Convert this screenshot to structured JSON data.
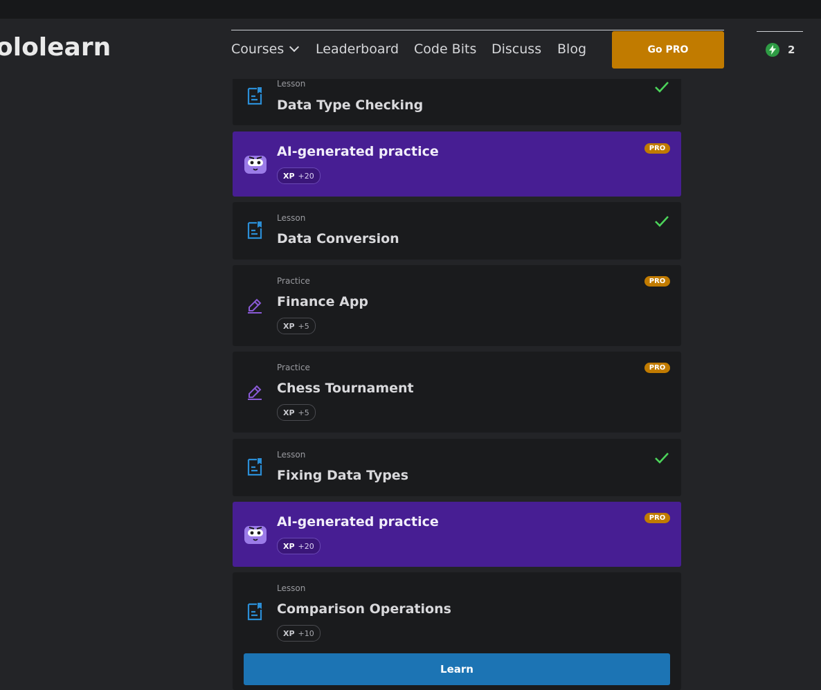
{
  "header": {
    "logo_text": "ololearn",
    "nav": {
      "courses": "Courses",
      "leaderboard": "Leaderboard",
      "code_bits": "Code Bits",
      "discuss": "Discuss",
      "blog": "Blog"
    },
    "go_pro": "Go PRO",
    "streak_count": "2"
  },
  "colors": {
    "background": "#232427",
    "card": "#1a1b1d",
    "ai_card": "#471e93",
    "pro_badge": "#c17b00",
    "learn_button": "#1c74b4",
    "check": "#4cd45a",
    "lesson_icon": "#2b8ed6",
    "practice_icon": "#8a5ad6"
  },
  "items": [
    {
      "type": "Lesson",
      "title": "Data Type Checking",
      "completed": true,
      "icon": "lesson-icon"
    },
    {
      "type": "",
      "title": "AI-generated practice",
      "xp_label": "XP",
      "xp": "+20",
      "pro": "PRO",
      "icon": "mascot-icon"
    },
    {
      "type": "Lesson",
      "title": "Data Conversion",
      "completed": true,
      "icon": "lesson-icon"
    },
    {
      "type": "Practice",
      "title": "Finance App",
      "xp_label": "XP",
      "xp": "+5",
      "pro": "PRO",
      "icon": "practice-icon"
    },
    {
      "type": "Practice",
      "title": "Chess Tournament",
      "xp_label": "XP",
      "xp": "+5",
      "pro": "PRO",
      "icon": "practice-icon"
    },
    {
      "type": "Lesson",
      "title": "Fixing Data Types",
      "completed": true,
      "icon": "lesson-icon"
    },
    {
      "type": "",
      "title": "AI-generated practice",
      "xp_label": "XP",
      "xp": "+20",
      "pro": "PRO",
      "icon": "mascot-icon"
    },
    {
      "type": "Lesson",
      "title": "Comparison Operations",
      "xp_label": "XP",
      "xp": "+10",
      "button": "Learn",
      "icon": "lesson-icon"
    }
  ]
}
